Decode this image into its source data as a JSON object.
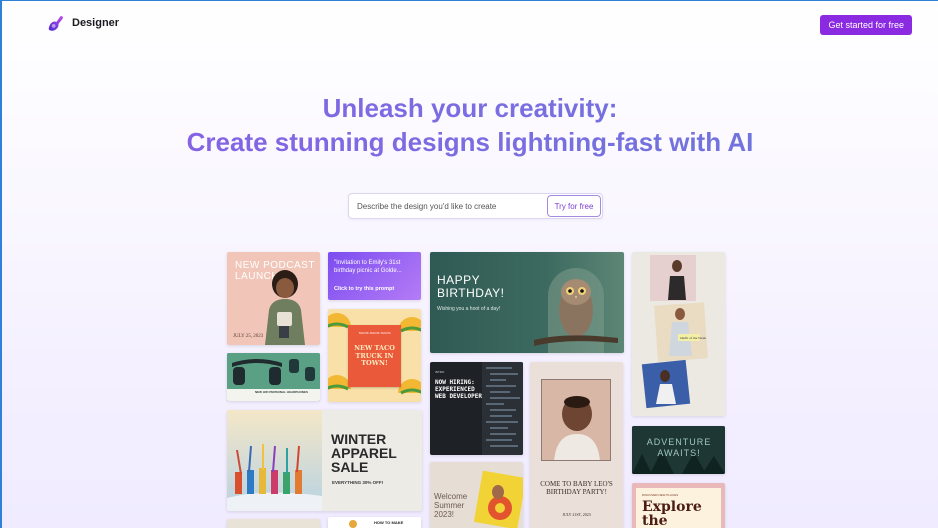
{
  "header": {
    "brand": "Designer",
    "cta_label": "Get started for free"
  },
  "hero": {
    "line1": "Unleash your creativity:",
    "line2": "Create stunning designs lightning-fast with AI"
  },
  "search": {
    "placeholder": "Describe the design you'd like to create",
    "button_label": "Try for free"
  },
  "gallery": {
    "podcast": {
      "title": "NEW PODCAST LAUNCH",
      "date": "JULY 25, 2023"
    },
    "prompt": {
      "text": "\"Invitation to Emily's 31st birthday picnic at Golde...",
      "cta": "Click to try this prompt"
    },
    "taco": {
      "kicker": "TACOS TACOS TACOS",
      "title": "NEW TACO TRUCK IN TOWN!"
    },
    "birthday": {
      "title": "HAPPY BIRTHDAY!",
      "subtitle": "Wishing you a hoot of a day!"
    },
    "headphones": {
      "caption": "NEW HIFI PERSONAL HEADPHONES"
    },
    "hiring": {
      "kicker": "INTRO",
      "title": "NOW HIRING: EXPERIENCED WEB DEVELOPER"
    },
    "baby": {
      "title": "COME TO BABY LEO'S BIRTHDAY PARTY!",
      "date": "JULY 21ST, 2023"
    },
    "fashion": {
      "caption": "Outfit of the Week"
    },
    "adventure": {
      "title": "ADVENTURE AWAITS!"
    },
    "winter": {
      "title": "WINTER APPAREL SALE",
      "subtitle": "EVERYTHING 30% OFF!"
    },
    "summer": {
      "title": "Welcome Summer 2023!"
    },
    "howto": {
      "title": "HOW TO MAKE"
    },
    "explore": {
      "kicker": "DISCOVER NEW PLACES",
      "title": "Explore the World"
    }
  },
  "colors": {
    "accent": "#8a2be2",
    "hero_gradient_start": "#8a5de6",
    "hero_gradient_end": "#6a78d8"
  }
}
